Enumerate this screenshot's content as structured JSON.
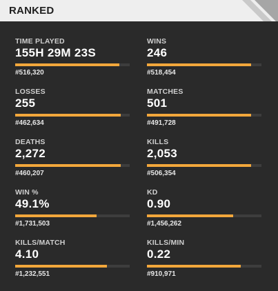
{
  "header": {
    "title": "RANKED"
  },
  "colors": {
    "accent": "#f2a73b",
    "background": "#2a2a2a",
    "header_bg": "#eeeeee"
  },
  "stats": [
    {
      "label": "TIME PLAYED",
      "value": "155H 29M 23S",
      "rank": "#516,320",
      "fill": 0.91
    },
    {
      "label": "WINS",
      "value": "246",
      "rank": "#518,454",
      "fill": 0.91
    },
    {
      "label": "LOSSES",
      "value": "255",
      "rank": "#462,634",
      "fill": 0.92
    },
    {
      "label": "MATCHES",
      "value": "501",
      "rank": "#491,728",
      "fill": 0.91
    },
    {
      "label": "DEATHS",
      "value": "2,272",
      "rank": "#460,207",
      "fill": 0.92
    },
    {
      "label": "KILLS",
      "value": "2,053",
      "rank": "#506,354",
      "fill": 0.91
    },
    {
      "label": "WIN %",
      "value": "49.1%",
      "rank": "#1,731,503",
      "fill": 0.71
    },
    {
      "label": "KD",
      "value": "0.90",
      "rank": "#1,456,262",
      "fill": 0.75
    },
    {
      "label": "KILLS/MATCH",
      "value": "4.10",
      "rank": "#1,232,551",
      "fill": 0.8
    },
    {
      "label": "KILLS/MIN",
      "value": "0.22",
      "rank": "#910,971",
      "fill": 0.82
    }
  ]
}
